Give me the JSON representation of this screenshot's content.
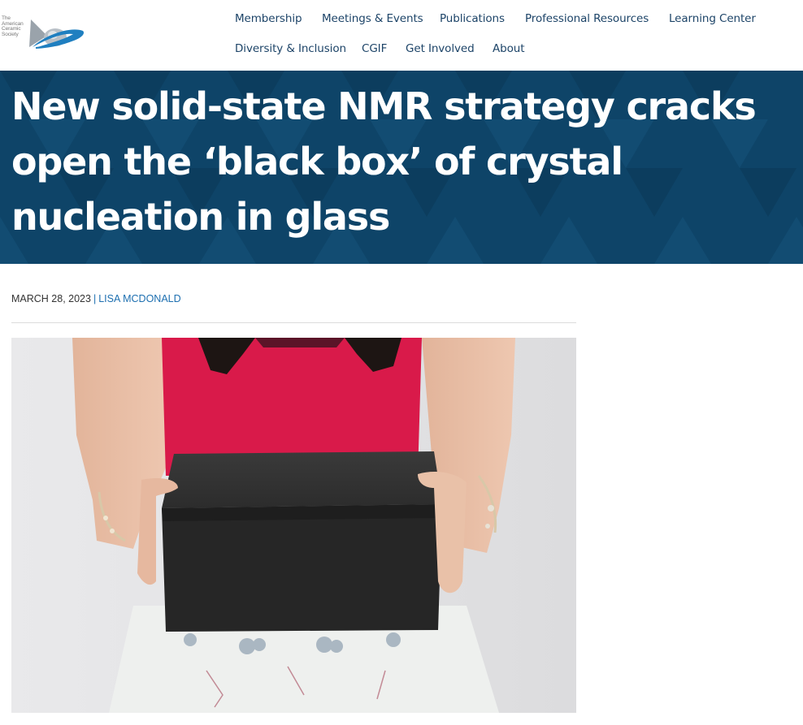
{
  "header": {
    "logo_text": [
      "The",
      "American",
      "Ceramic",
      "Society"
    ],
    "nav_row1": [
      "Membership",
      "Meetings & Events",
      "Publications",
      "Professional Resources",
      "Learning Center"
    ],
    "nav_row2": [
      "Diversity & Inclusion",
      "CGIF",
      "Get Involved",
      "About"
    ]
  },
  "article": {
    "title": "New solid-state NMR strategy cracks open the ‘black box’ of crystal nucleation in glass",
    "date": "MARCH 28, 2023",
    "separator": "|",
    "author": "LISA MCDONALD"
  },
  "colors": {
    "brand_navy": "#0e4468",
    "nav_text": "#1d4468",
    "link_blue": "#1d6fb0"
  }
}
